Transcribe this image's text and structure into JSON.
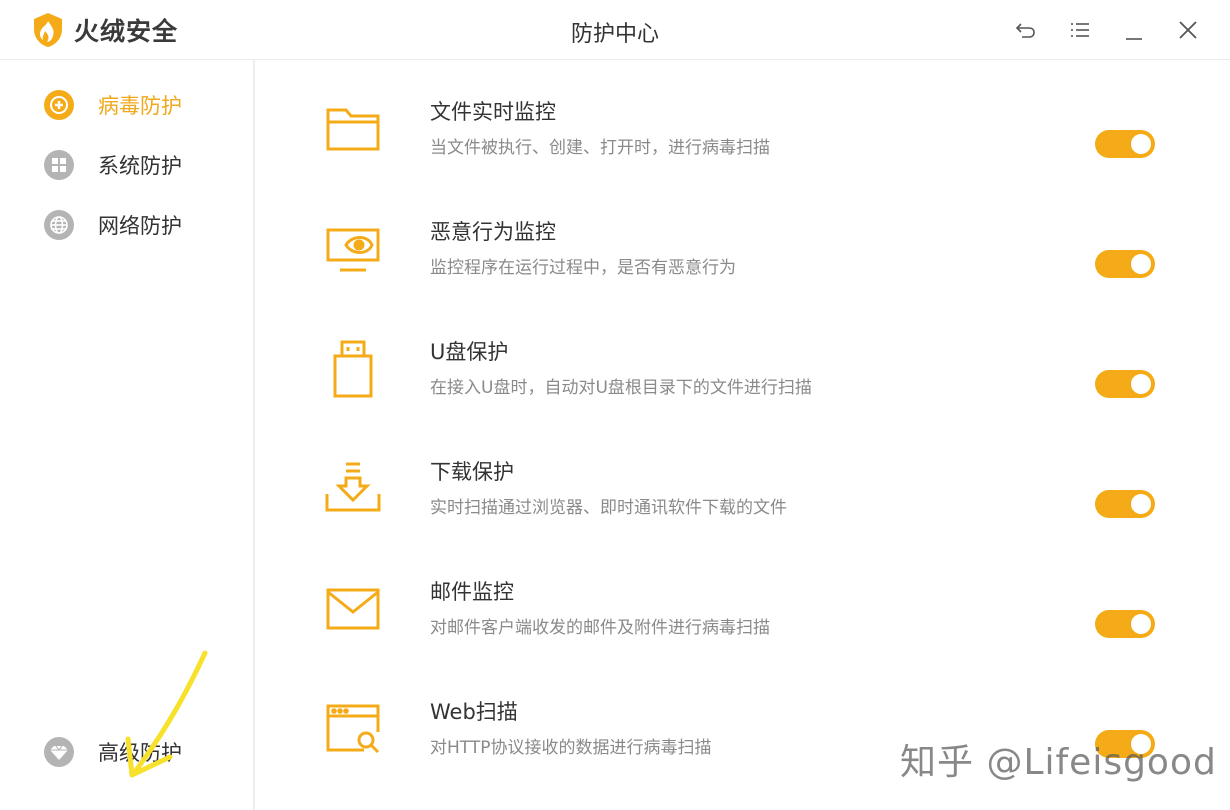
{
  "app": {
    "name": "火绒安全",
    "window_title": "防护中心"
  },
  "colors": {
    "accent": "#f5ab18",
    "sidebar_icon_gray": "#b4b4b4",
    "annotation_arrow": "#f7e12b"
  },
  "titlebar_icons": [
    "back-icon",
    "menu-icon",
    "minimize-icon",
    "close-icon"
  ],
  "sidebar": {
    "items": [
      {
        "label": "病毒防护",
        "icon": "plus-circle-icon",
        "active": true
      },
      {
        "label": "系统防护",
        "icon": "windows-icon",
        "active": false
      },
      {
        "label": "网络防护",
        "icon": "globe-icon",
        "active": false
      },
      {
        "label": "高级防护",
        "icon": "diamond-icon",
        "active": false
      }
    ]
  },
  "features": [
    {
      "title": "文件实时监控",
      "desc": "当文件被执行、创建、打开时，进行病毒扫描",
      "icon": "folder-icon",
      "enabled": true
    },
    {
      "title": "恶意行为监控",
      "desc": "监控程序在运行过程中，是否有恶意行为",
      "icon": "monitor-eye-icon",
      "enabled": true
    },
    {
      "title": "U盘保护",
      "desc": "在接入U盘时，自动对U盘根目录下的文件进行扫描",
      "icon": "usb-drive-icon",
      "enabled": true
    },
    {
      "title": "下载保护",
      "desc": "实时扫描通过浏览器、即时通讯软件下载的文件",
      "icon": "download-tray-icon",
      "enabled": true
    },
    {
      "title": "邮件监控",
      "desc": "对邮件客户端收发的邮件及附件进行病毒扫描",
      "icon": "envelope-icon",
      "enabled": true
    },
    {
      "title": "Web扫描",
      "desc": "对HTTP协议接收的数据进行病毒扫描",
      "icon": "browser-search-icon",
      "enabled": true
    }
  ],
  "watermark": "知乎 @Lifeisgood"
}
